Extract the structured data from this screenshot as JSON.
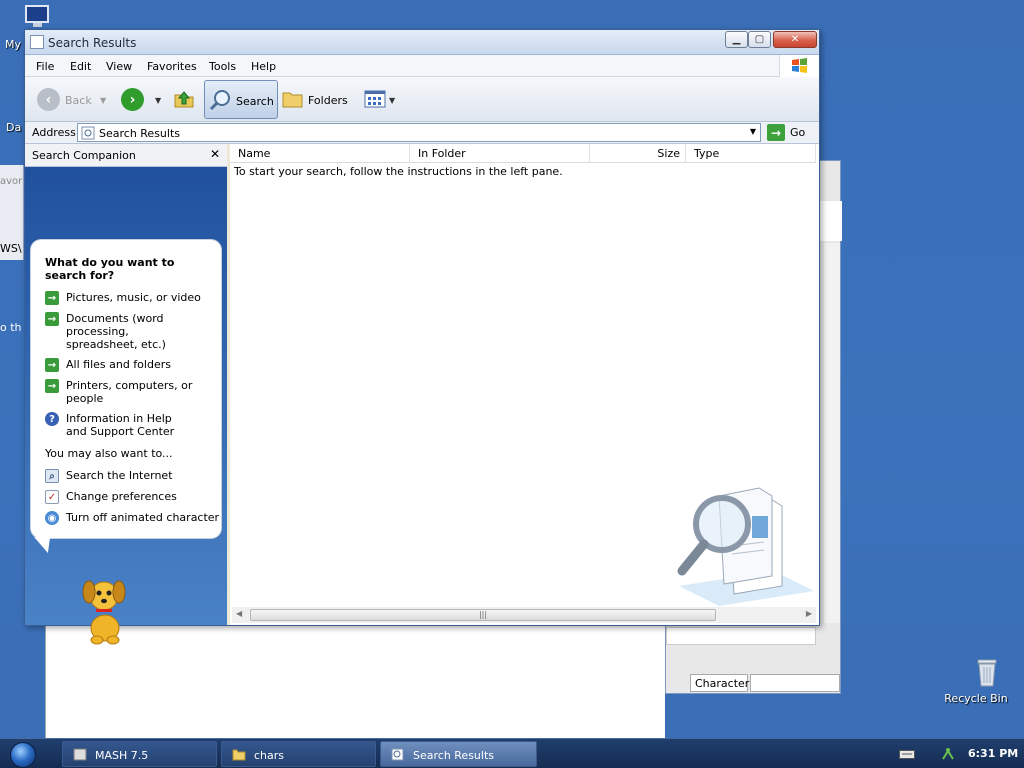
{
  "desktop": {
    "icons": [
      {
        "label": "My"
      },
      {
        "label": "Da"
      },
      {
        "label": "Recycle Bin"
      }
    ],
    "bg_fragments": {
      "left_text_1": "avor",
      "left_text_2": "WS\\",
      "left_text_3": "o th"
    }
  },
  "window": {
    "title": "Search Results",
    "menu": [
      "File",
      "Edit",
      "View",
      "Favorites",
      "Tools",
      "Help"
    ],
    "toolbar": {
      "back_label": "Back",
      "search_label": "Search",
      "folders_label": "Folders"
    },
    "address": {
      "label": "Address",
      "value": "Search Results",
      "go_label": "Go"
    },
    "search_pane": {
      "title": "Search Companion",
      "close_glyph": "✕",
      "question": "What do you want to search for?",
      "options": [
        {
          "label": "Pictures, music, or video",
          "icon": "green-arrow-icon"
        },
        {
          "label": "Documents (word processing, spreadsheet, etc.)",
          "icon": "green-arrow-icon"
        },
        {
          "label": "All files and folders",
          "icon": "green-arrow-icon"
        },
        {
          "label": "Printers, computers, or people",
          "icon": "green-arrow-icon"
        },
        {
          "label": "Information in Help and Support Center",
          "icon": "help-icon"
        }
      ],
      "also_heading": "You may also want to...",
      "also_options": [
        {
          "label": "Search the Internet",
          "icon": "search-internet-icon"
        },
        {
          "label": "Change preferences",
          "icon": "preferences-icon"
        },
        {
          "label": "Turn off animated character",
          "icon": "globe-icon"
        }
      ]
    },
    "list": {
      "columns": [
        "Name",
        "In Folder",
        "Size",
        "Type"
      ],
      "message": "To start your search, follow the instructions in the left pane."
    }
  },
  "background_window": {
    "status_label": "Character:"
  },
  "taskbar": {
    "buttons": [
      {
        "label": "MASH 7.5",
        "active": false
      },
      {
        "label": "chars",
        "active": false
      },
      {
        "label": "Search Results",
        "active": true
      }
    ],
    "time": "6:31 PM"
  }
}
